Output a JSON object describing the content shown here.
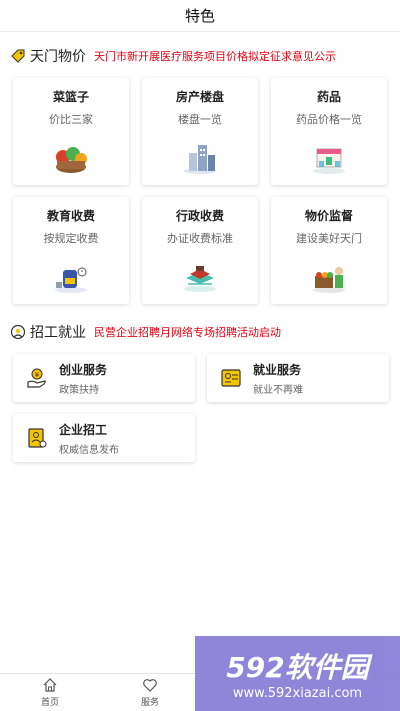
{
  "header": {
    "title": "特色"
  },
  "prices": {
    "title": "天门物价",
    "notice": "天门市新开展医疗服务项目价格拟定征求意见公示",
    "cards": [
      {
        "title": "菜篮子",
        "subtitle": "价比三家",
        "icon": "vegetable-basket-icon"
      },
      {
        "title": "房产楼盘",
        "subtitle": "楼盘一览",
        "icon": "buildings-icon"
      },
      {
        "title": "药品",
        "subtitle": "药品价格一览",
        "icon": "pharmacy-icon"
      },
      {
        "title": "教育收费",
        "subtitle": "按规定收费",
        "icon": "school-bag-icon"
      },
      {
        "title": "行政收费",
        "subtitle": "办证收费标准",
        "icon": "admin-office-icon"
      },
      {
        "title": "物价监督",
        "subtitle": "建设美好天门",
        "icon": "market-stall-icon"
      }
    ]
  },
  "jobs": {
    "title": "招工就业",
    "notice": "民营企业招聘月网络专场招聘活动启动",
    "cards": [
      {
        "title": "创业服务",
        "subtitle": "政策扶持",
        "icon": "money-hand-icon"
      },
      {
        "title": "就业服务",
        "subtitle": "就业不再难",
        "icon": "id-card-icon"
      },
      {
        "title": "企业招工",
        "subtitle": "权威信息发布",
        "icon": "recruit-doc-icon"
      }
    ]
  },
  "tabbar": [
    {
      "label": "首页",
      "icon": "home-icon"
    },
    {
      "label": "服务",
      "icon": "heart-icon"
    }
  ],
  "watermark": {
    "text": "592软件园",
    "url": "www.592xiazai.com"
  }
}
